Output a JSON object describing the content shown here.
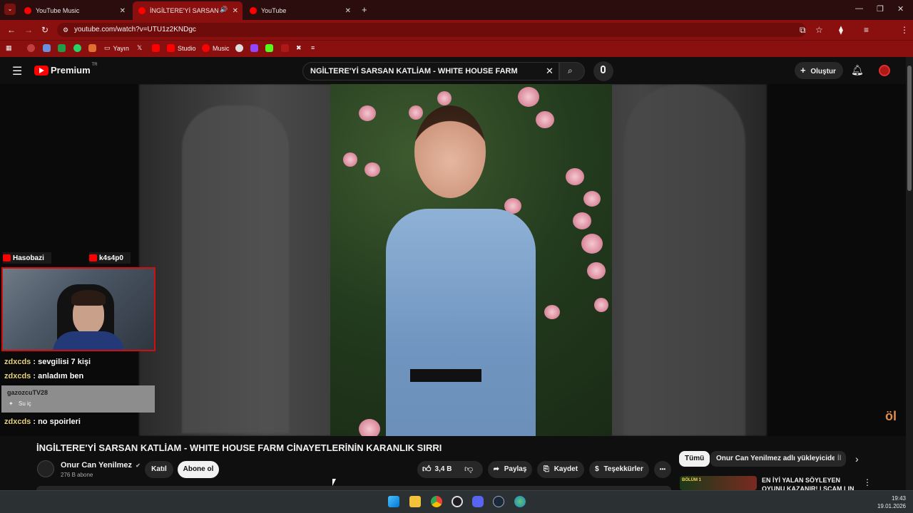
{
  "browser": {
    "tabs": [
      {
        "label": "YouTube Music"
      },
      {
        "label": "İNGİLTERE'Yİ SARSAN KATLİ"
      },
      {
        "label": "YouTube"
      }
    ],
    "url": "youtube.com/watch?v=UTU1z2KNDgc",
    "bookmarks": [
      "Yayın",
      "Studio",
      "Music"
    ]
  },
  "youtube": {
    "logo": "Premium",
    "logo_region": "TR",
    "search_value": "NGİLTERE'Yİ SARSAN KATLİAM - WHITE HOUSE FARM",
    "create_label": "Oluştur"
  },
  "overlay": {
    "channels": [
      "Hasobazi",
      "k4s4p0"
    ],
    "chat": [
      {
        "user": "zdxcds",
        "message": ": sevgilisi 7 kişi"
      },
      {
        "user": "zdxcds",
        "message": ": anladım ben"
      },
      {
        "user": "zdxcds",
        "message": ": no spoirleri"
      }
    ],
    "donation": {
      "user": "gazozcuTV28",
      "message": "Su iç"
    },
    "watermark": "öl"
  },
  "video": {
    "title": "İNGİLTERE'Yİ SARSAN KATLİAM - WHITE HOUSE FARM CİNAYETLERİNİN KARANLIK SIRRI",
    "channel": "Onur Can Yenilmez",
    "subscribers": "276 B abone",
    "join_label": "Katıl",
    "subscribe_label": "Abone ol",
    "likes": "3,4 B",
    "share_label": "Paylaş",
    "save_label": "Kaydet",
    "thanks_label": "Teşekkürler",
    "more_label": "•••"
  },
  "sidebar": {
    "chips": [
      "Tümü",
      "Onur Can Yenilmez adlı yükleyiciden",
      "İl"
    ],
    "recommendation": {
      "badge": "BÖLÜM 1",
      "title": "EN İYİ YALAN SÖYLEYEN OYUNU KAZANIR! | SCAM LIN"
    }
  },
  "taskbar": {
    "time": "19:43",
    "date": "19.01.2026"
  },
  "colors": {
    "browser_accent": "#8a1010",
    "youtube_red": "#ff0000",
    "background": "#0f0f0f"
  }
}
